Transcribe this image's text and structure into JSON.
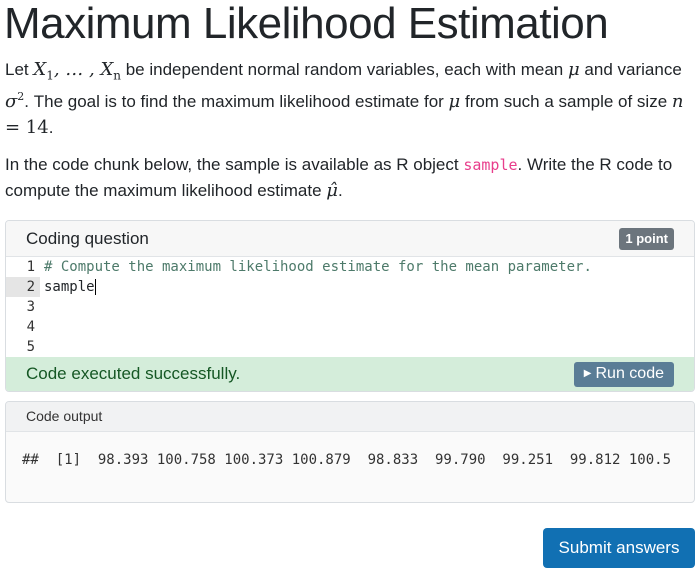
{
  "page": {
    "title": "Maximum Likelihood Estimation"
  },
  "intro": {
    "p1_a": "Let ",
    "x1": "X",
    "x1_sub": "1",
    "dots": ", … , ",
    "xn": "X",
    "xn_sub": "n",
    "p1_b": " be independent normal random variables, each with mean ",
    "mu": "μ",
    "p1_c": " and variance ",
    "sigma": "σ",
    "sigma_sup": "2",
    "p1_d": ". The goal is to find the maximum likelihood estimate for ",
    "mu2": "μ",
    "p1_e": " from such a sample of size ",
    "n_eq": "n",
    "eq": " = 14",
    "p1_f": ".",
    "p2_a": "In the code chunk below, the sample is available as R object ",
    "p2_code": "sample",
    "p2_b": ". Write the R code to compute the maximum likelihood estimate ",
    "muhat": "μ̂",
    "p2_c": "."
  },
  "question": {
    "header": "Coding question",
    "badge": "1 point",
    "lines": [
      {
        "num": "1",
        "text": "# Compute the maximum likelihood estimate for the mean parameter."
      },
      {
        "num": "2",
        "text": "sample"
      },
      {
        "num": "3",
        "text": ""
      },
      {
        "num": "4",
        "text": ""
      },
      {
        "num": "5",
        "text": ""
      }
    ],
    "status": "Code executed successfully.",
    "run_label": "Run code",
    "run_icon": "play-icon"
  },
  "output": {
    "header": "Code output",
    "text": "##  [1]  98.393 100.758 100.373 100.879  98.833  99.790  99.251  99.812 100.5"
  },
  "submit": {
    "label": "Submit answers"
  },
  "colors": {
    "primary": "#1170b3",
    "success_bg": "#d4edda",
    "success_text": "#155724",
    "run_button": "#5a7d96",
    "badge": "#6c757d",
    "inline_code": "#e83e8c"
  }
}
